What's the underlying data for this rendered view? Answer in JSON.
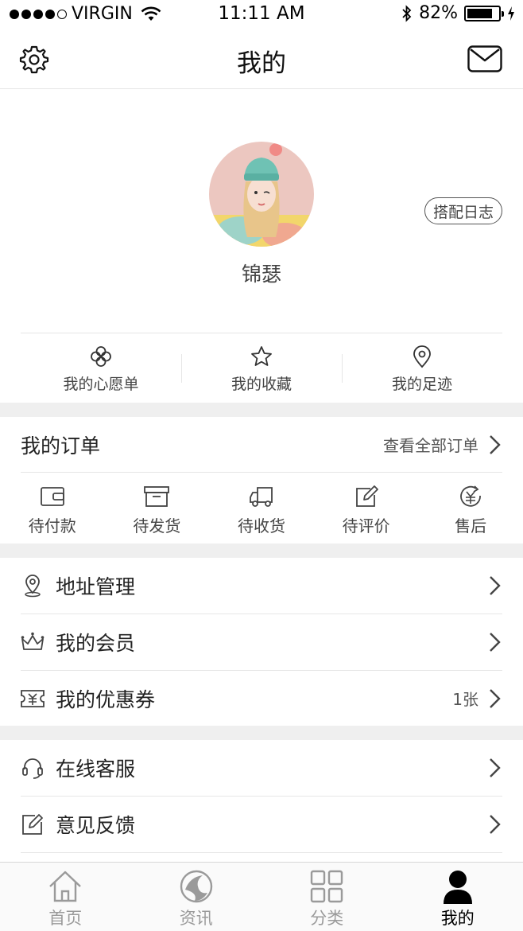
{
  "status_bar": {
    "carrier": "VIRGIN",
    "time": "11:11 AM",
    "battery": "82%",
    "battery_level": 0.82
  },
  "nav": {
    "title": "我的",
    "settings_icon": "gear-icon",
    "mail_icon": "mail-icon"
  },
  "profile": {
    "username": "锦瑟",
    "diary_label": "搭配日志"
  },
  "quick_links": [
    {
      "label": "我的心愿单",
      "icon": "clover-icon"
    },
    {
      "label": "我的收藏",
      "icon": "star-icon"
    },
    {
      "label": "我的足迹",
      "icon": "location-pin-icon"
    }
  ],
  "orders": {
    "title": "我的订单",
    "view_all": "查看全部订单",
    "items": [
      {
        "label": "待付款",
        "icon": "wallet-icon"
      },
      {
        "label": "待发货",
        "icon": "box-icon"
      },
      {
        "label": "待收货",
        "icon": "truck-icon"
      },
      {
        "label": "待评价",
        "icon": "edit-icon"
      },
      {
        "label": "售后",
        "icon": "refund-icon"
      }
    ]
  },
  "menu_group1": [
    {
      "label": "地址管理",
      "icon": "location-icon"
    },
    {
      "label": "我的会员",
      "icon": "crown-icon"
    },
    {
      "label": "我的优惠券",
      "icon": "coupon-icon",
      "badge": "1张"
    }
  ],
  "menu_group2": [
    {
      "label": "在线客服",
      "icon": "headset-icon"
    },
    {
      "label": "意见反馈",
      "icon": "feedback-icon"
    }
  ],
  "tab_bar": [
    {
      "label": "首页",
      "icon": "home-icon",
      "active": false
    },
    {
      "label": "资讯",
      "icon": "news-icon",
      "active": false
    },
    {
      "label": "分类",
      "icon": "grid-icon",
      "active": false
    },
    {
      "label": "我的",
      "icon": "user-icon",
      "active": true
    }
  ],
  "colors": {
    "separator": "#efefef",
    "divider": "#e6e6e6",
    "text_primary": "#222222",
    "tab_inactive": "#9a9a9a"
  }
}
